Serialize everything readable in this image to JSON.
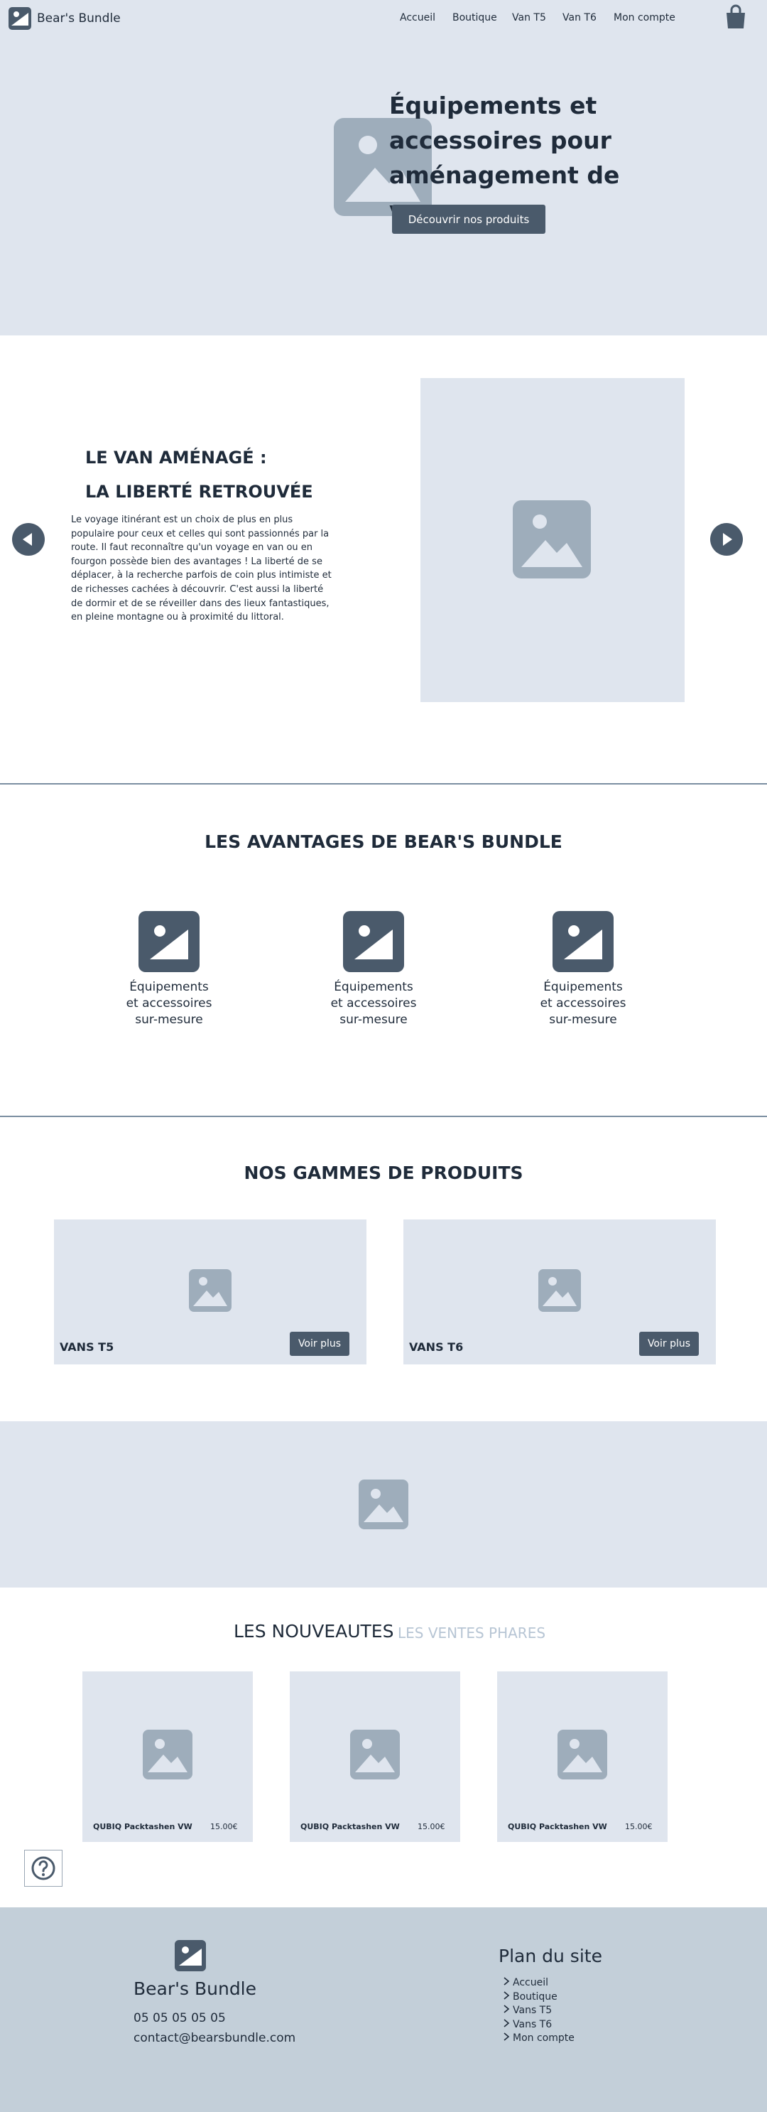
{
  "colors": {
    "accent": "#4a5a6b",
    "light_bg": "#dfe5ee",
    "footer_bg": "#c3cfd9",
    "placeholder_icon": "#9eadbb",
    "text": "#1f2b3a",
    "inactive_tab": "#b7c5d4"
  },
  "header": {
    "brand": "Bear's Bundle",
    "logo_icon": "image-icon",
    "nav": [
      {
        "label": "Accueil"
      },
      {
        "label": "Boutique"
      },
      {
        "label": "Van T5"
      },
      {
        "label": "Van T6"
      },
      {
        "label": "Mon compte"
      }
    ],
    "cart_icon": "shopping-bag-icon"
  },
  "hero": {
    "title": "Équipements et accessoires pour aménagement de vans",
    "cta": "Découvrir nos produits"
  },
  "slider": {
    "title_line1": "LE VAN AMÉNAGÉ :",
    "title_line2": "LA LIBERTÉ RETROUVÉE",
    "text": "Le voyage itinérant est un choix de plus en plus populaire pour ceux et celles qui sont passionnés par la route. Il faut reconnaître qu'un voyage en van ou en fourgon possède bien des avantages ! La liberté de se déplacer, à la recherche parfois de coin plus intimiste et de richesses cachées à découvrir. C'est aussi la liberté de dormir et de se réveiller dans des lieux fantastiques, en pleine montagne ou à proximité du littoral.",
    "prev_icon": "arrow-left-icon",
    "next_icon": "arrow-right-icon"
  },
  "advantages": {
    "title": "LES AVANTAGES DE BEAR'S BUNDLE",
    "items": [
      {
        "line1": "Équipements",
        "line2": "et accessoires",
        "line3": "sur-mesure"
      },
      {
        "line1": "Équipements",
        "line2": "et accessoires",
        "line3": "sur-mesure"
      },
      {
        "line1": "Équipements",
        "line2": "et accessoires",
        "line3": "sur-mesure"
      }
    ]
  },
  "ranges": {
    "title": "NOS GAMMES DE PRODUITS",
    "items": [
      {
        "label": "VANS T5",
        "button": "Voir plus"
      },
      {
        "label": "VANS T6",
        "button": "Voir plus"
      }
    ]
  },
  "products": {
    "tabs": [
      {
        "label": "LES NOUVEAUTES",
        "active": true
      },
      {
        "label": "LES VENTES PHARES",
        "active": false
      }
    ],
    "items": [
      {
        "name": "QUBIQ Packtashen VW",
        "price": "15.00€"
      },
      {
        "name": "QUBIQ Packtashen VW",
        "price": "15.00€"
      },
      {
        "name": "QUBIQ Packtashen VW",
        "price": "15.00€"
      }
    ]
  },
  "help": {
    "icon": "help-icon"
  },
  "footer": {
    "brand": "Bear's Bundle",
    "phone": "05 05 05 05 05",
    "email": "contact@bearsbundle.com",
    "sitemap_title": "Plan du site",
    "links": [
      {
        "label": "Accueil"
      },
      {
        "label": "Boutique"
      },
      {
        "label": "Vans T5"
      },
      {
        "label": "Vans T6"
      },
      {
        "label": "Mon compte"
      }
    ]
  }
}
